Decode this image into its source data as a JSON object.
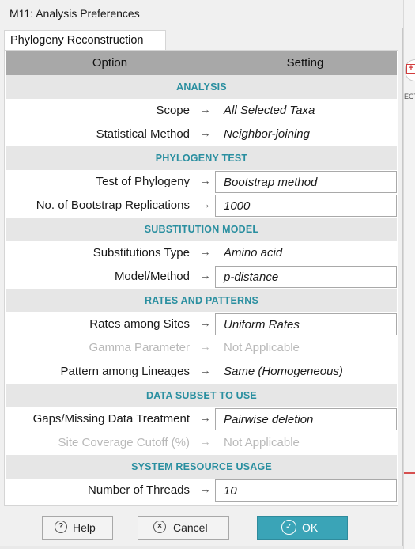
{
  "window": {
    "title": "M11: Analysis Preferences"
  },
  "tabs": [
    {
      "label": "Phylogeny Reconstruction"
    }
  ],
  "grid": {
    "header": {
      "option": "Option",
      "setting": "Setting"
    },
    "arrow": "→",
    "sections": [
      {
        "label": "ANALYSIS",
        "rows": [
          {
            "option": "Scope",
            "value": "All Selected Taxa",
            "editable": false,
            "enabled": true
          },
          {
            "option": "Statistical Method",
            "value": "Neighbor-joining",
            "editable": false,
            "enabled": true
          }
        ]
      },
      {
        "label": "PHYLOGENY TEST",
        "rows": [
          {
            "option": "Test of Phylogeny",
            "value": "Bootstrap method",
            "editable": true,
            "enabled": true
          },
          {
            "option": "No. of Bootstrap Replications",
            "value": "1000",
            "editable": true,
            "enabled": true
          }
        ]
      },
      {
        "label": "SUBSTITUTION MODEL",
        "rows": [
          {
            "option": "Substitutions Type",
            "value": "Amino acid",
            "editable": false,
            "enabled": true
          },
          {
            "option": "Model/Method",
            "value": "p-distance",
            "editable": true,
            "enabled": true
          }
        ]
      },
      {
        "label": "RATES AND PATTERNS",
        "rows": [
          {
            "option": "Rates among Sites",
            "value": "Uniform Rates",
            "editable": true,
            "enabled": true
          },
          {
            "option": "Gamma Parameter",
            "value": "Not Applicable",
            "editable": false,
            "enabled": false
          },
          {
            "option": "Pattern among Lineages",
            "value": "Same (Homogeneous)",
            "editable": false,
            "enabled": true
          }
        ]
      },
      {
        "label": "DATA SUBSET TO USE",
        "rows": [
          {
            "option": "Gaps/Missing Data Treatment",
            "value": "Pairwise deletion",
            "editable": true,
            "enabled": true
          },
          {
            "option": "Site Coverage Cutoff (%)",
            "value": "Not Applicable",
            "editable": false,
            "enabled": false
          }
        ]
      },
      {
        "label": "SYSTEM RESOURCE USAGE",
        "rows": [
          {
            "option": "Number of Threads",
            "value": "10",
            "editable": true,
            "enabled": true
          }
        ]
      }
    ]
  },
  "buttons": {
    "help": {
      "label": "Help",
      "icon": "?"
    },
    "cancel": {
      "label": "Cancel",
      "icon": "×"
    },
    "ok": {
      "label": "OK",
      "icon": "✓"
    }
  },
  "background": {
    "toolbar_label": "ECT",
    "accent": "#3aa4b7"
  }
}
